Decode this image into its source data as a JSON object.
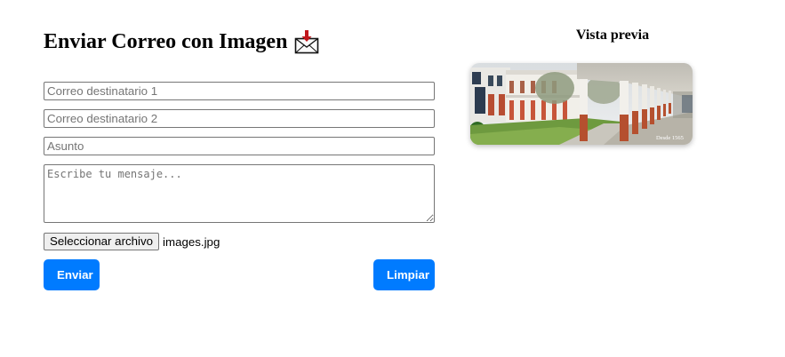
{
  "form": {
    "title": "Enviar Correo con Imagen",
    "title_icon": "incoming-envelope-icon",
    "recipient1_placeholder": "Correo destinatario 1",
    "recipient2_placeholder": "Correo destinatario 2",
    "subject_placeholder": "Asunto",
    "message_placeholder": "Escribe tu mensaje...",
    "file_button_label": "Seleccionar archivo",
    "file_name": "images.jpg",
    "send_label": "Enviar",
    "clear_label": "Limpiar"
  },
  "preview": {
    "title": "Vista previa",
    "image_caption": "Desde 1565"
  },
  "colors": {
    "accent": "#007bff",
    "text": "#000000",
    "background": "#ffffff"
  }
}
